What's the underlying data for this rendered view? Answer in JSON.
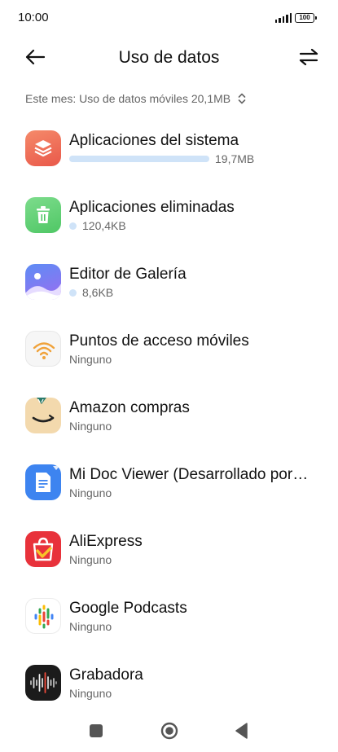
{
  "status": {
    "time": "10:00",
    "battery": "100"
  },
  "header": {
    "title": "Uso de datos"
  },
  "filter": {
    "label": "Este mes: Uso de datos móviles 20,1MB"
  },
  "apps": [
    {
      "name": "Aplicaciones del sistema",
      "usage": "19,7MB",
      "icon": "layers-icon",
      "usage_fraction": 0.98
    },
    {
      "name": "Aplicaciones eliminadas",
      "usage": "120,4KB",
      "icon": "trash-icon"
    },
    {
      "name": "Editor de Galería",
      "usage": "8,6KB",
      "icon": "gallery-icon"
    },
    {
      "name": "Puntos de acceso móviles",
      "usage": "Ninguno",
      "icon": "hotspot-icon"
    },
    {
      "name": "Amazon compras",
      "usage": "Ninguno",
      "icon": "amazon-icon"
    },
    {
      "name": "Mi Doc Viewer (Desarrollado por…",
      "usage": "Ninguno",
      "icon": "document-icon"
    },
    {
      "name": "AliExpress",
      "usage": "Ninguno",
      "icon": "aliexpress-icon"
    },
    {
      "name": "Google Podcasts",
      "usage": "Ninguno",
      "icon": "podcasts-icon"
    },
    {
      "name": "Grabadora",
      "usage": "Ninguno",
      "icon": "recorder-icon"
    }
  ],
  "colors": {
    "usage_bar": "#cfe3f8",
    "text_secondary": "#666666"
  }
}
